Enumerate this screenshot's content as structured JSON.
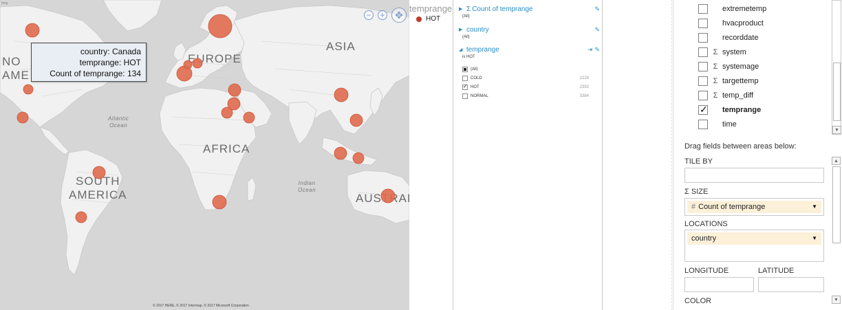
{
  "map": {
    "continents": {
      "north_america": "NO\nAME",
      "europe": "EUROPE",
      "asia": "ASIA",
      "africa": "AFRICA",
      "south_america": "SOUTH\nAMERICA",
      "australia": "AUSTRALI"
    },
    "oceans": {
      "atlantic": "Atlantic\nOcean",
      "indian": "Indian\nOcean"
    },
    "copyright": "© 2017 HERE, © 2017 Intermap, © 2017 Microsoft Corporation",
    "logo": "bing",
    "controls": {
      "zoom_out": "−",
      "zoom_in": "+",
      "pan": "✥"
    },
    "bubble_color": "#e06a4c",
    "tooltip": {
      "country_label": "country:",
      "country_value": "Canada",
      "temprange_label": "temprange:",
      "temprange_value": "HOT",
      "count_label": "Count of temprange:",
      "count_value": "134"
    }
  },
  "legend": {
    "title": "temprange",
    "items": [
      {
        "label": "HOT",
        "color": "#c0392b"
      }
    ]
  },
  "filters": {
    "blocks": [
      {
        "title": "Count of temprange",
        "sub": "(All)",
        "expanded": false,
        "sigma": true
      },
      {
        "title": "country",
        "sub": "(All)",
        "expanded": false,
        "sigma": false
      },
      {
        "title": "temprange",
        "sub": "is HOT",
        "expanded": true,
        "sigma": false
      }
    ],
    "temprange_values": [
      {
        "label": "(All)",
        "count": "",
        "state": "partial"
      },
      {
        "label": "COLD",
        "count": "2224",
        "state": "unchecked"
      },
      {
        "label": "HOT",
        "count": "2392",
        "state": "checked"
      },
      {
        "label": "NORMAL",
        "count": "3384",
        "state": "unchecked"
      }
    ]
  },
  "fieldlist": {
    "fields": [
      {
        "name": "extremetemp",
        "sigma": false,
        "checked": false,
        "bold": false
      },
      {
        "name": "hvacproduct",
        "sigma": false,
        "checked": false,
        "bold": false
      },
      {
        "name": "recorddate",
        "sigma": false,
        "checked": false,
        "bold": false
      },
      {
        "name": "system",
        "sigma": true,
        "checked": false,
        "bold": false
      },
      {
        "name": "systemage",
        "sigma": true,
        "checked": false,
        "bold": false
      },
      {
        "name": "targettemp",
        "sigma": true,
        "checked": false,
        "bold": false
      },
      {
        "name": "temp_diff",
        "sigma": true,
        "checked": false,
        "bold": false
      },
      {
        "name": "temprange",
        "sigma": false,
        "checked": true,
        "bold": true
      },
      {
        "name": "time",
        "sigma": false,
        "checked": false,
        "bold": false
      }
    ],
    "drag_title": "Drag fields between areas below:",
    "areas": {
      "tile_by": {
        "label": "TILE BY"
      },
      "size": {
        "label": "SIZE",
        "value": "Count of temprange"
      },
      "locations": {
        "label": "LOCATIONS",
        "value": "country"
      },
      "longitude": {
        "label": "LONGITUDE"
      },
      "latitude": {
        "label": "LATITUDE"
      },
      "color": {
        "label": "COLOR"
      }
    }
  }
}
